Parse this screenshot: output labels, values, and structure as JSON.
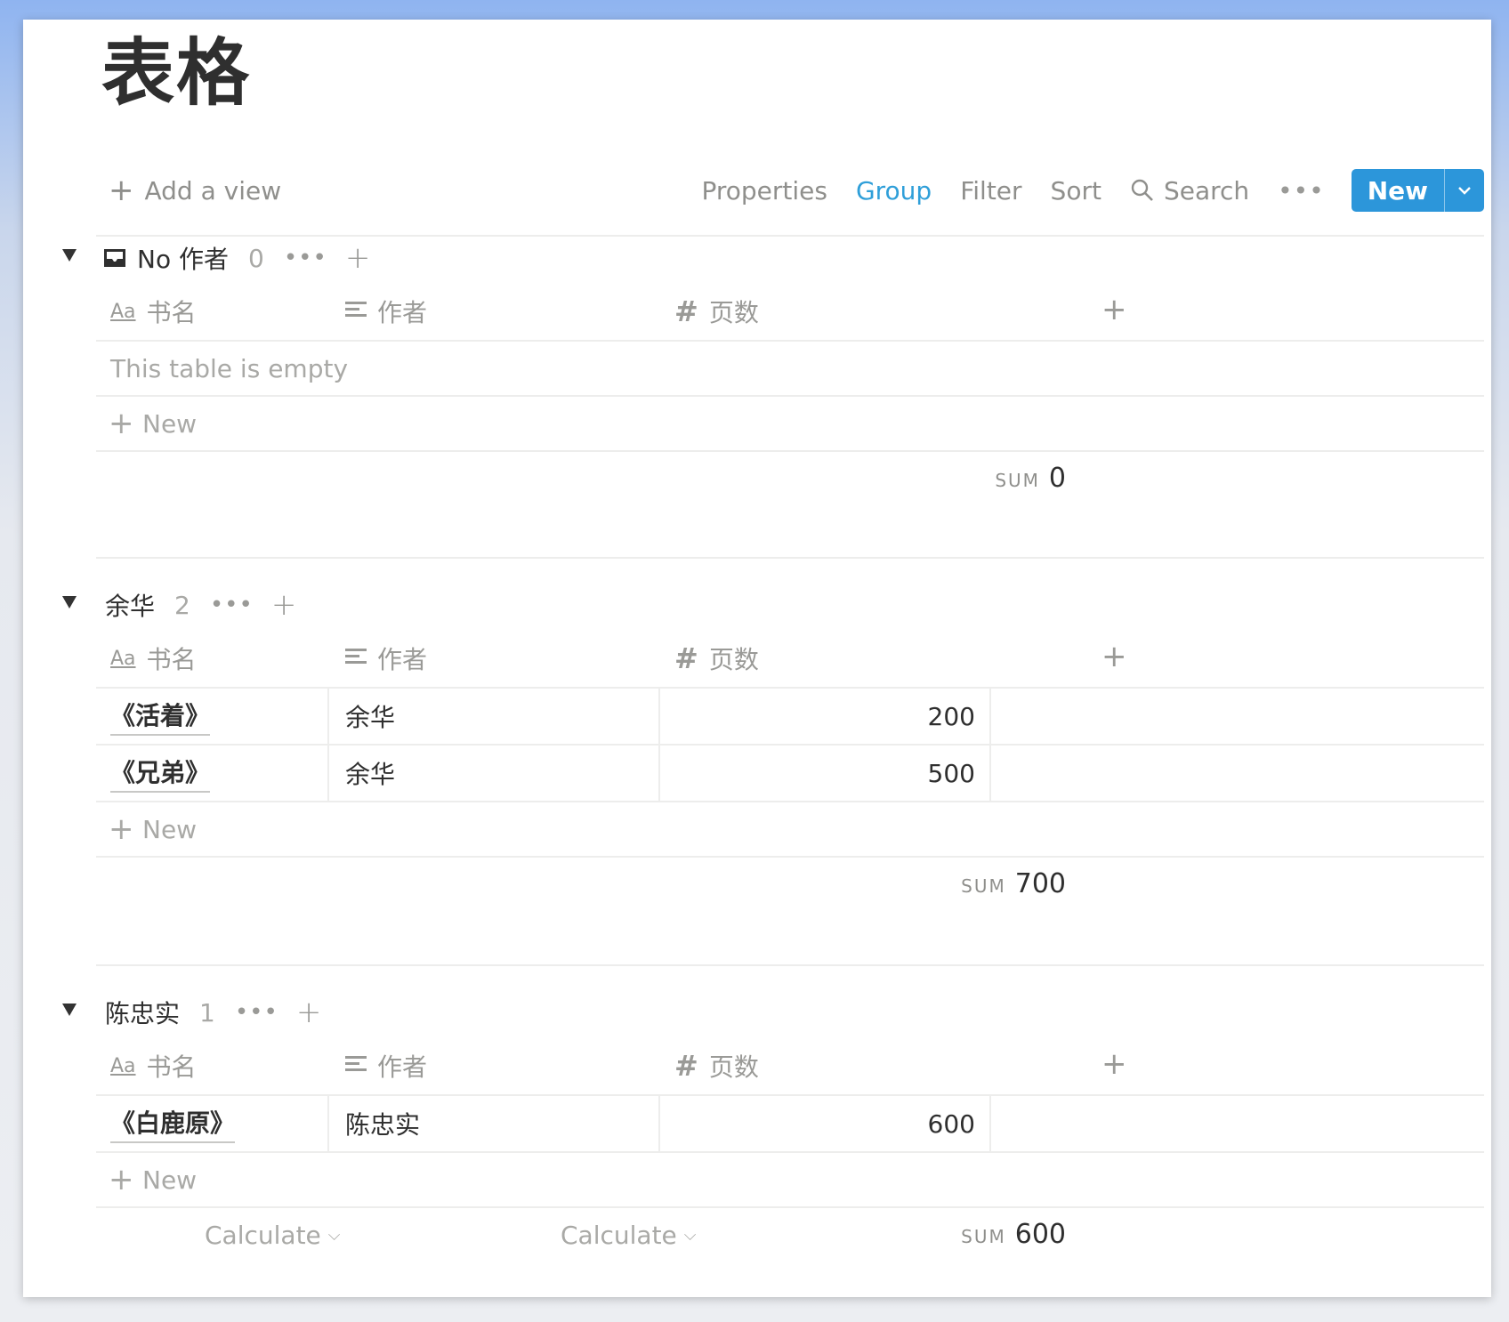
{
  "page": {
    "title": "表格"
  },
  "toolbar": {
    "add_view": "Add a view",
    "properties": "Properties",
    "group": "Group",
    "filter": "Filter",
    "sort": "Sort",
    "search": "Search",
    "more": "•••",
    "new": "New"
  },
  "columns": {
    "name": "书名",
    "author": "作者",
    "pages": "页数",
    "name_icon": "Aa"
  },
  "groups": [
    {
      "name": "No 作者",
      "count": "0",
      "empty_text": "This table is empty",
      "new_label": "New",
      "sum_label": "SUM",
      "sum_value": "0",
      "rows": []
    },
    {
      "name": "余华",
      "count": "2",
      "new_label": "New",
      "sum_label": "SUM",
      "sum_value": "700",
      "rows": [
        {
          "title": "《活着》",
          "author": "余华",
          "pages": "200"
        },
        {
          "title": "《兄弟》",
          "author": "余华",
          "pages": "500"
        }
      ]
    },
    {
      "name": "陈忠实",
      "count": "1",
      "new_label": "New",
      "sum_label": "SUM",
      "sum_value": "600",
      "rows": [
        {
          "title": "《白鹿原》",
          "author": "陈忠实",
          "pages": "600"
        }
      ],
      "calc_label": "Calculate"
    }
  ],
  "colors": {
    "accent": "#2c96da",
    "group_active": "#2f9fd9",
    "muted": "#9a9a97"
  }
}
